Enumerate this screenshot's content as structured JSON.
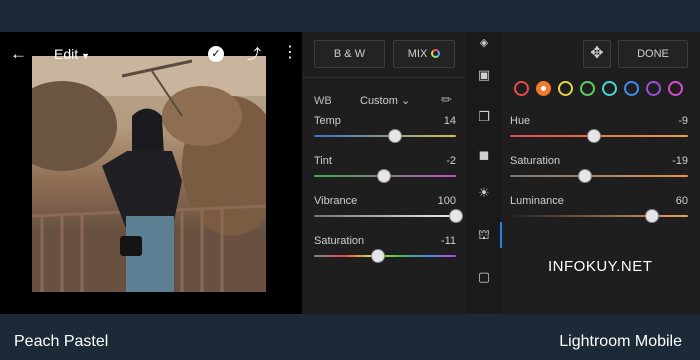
{
  "caption": {
    "left": "Peach Pastel",
    "right": "Lightroom Mobile"
  },
  "photo_panel": {
    "back_icon": "arrow-left-icon",
    "title": "Edit",
    "confirm_icon": "checkmark-circle-icon",
    "share_icon": "share-icon",
    "more_icon": "more-vertical-icon"
  },
  "color_panel": {
    "bw_label": "B & W",
    "mix_label": "MIX",
    "wb_label": "WB",
    "wb_value": "Custom",
    "sliders": [
      {
        "label": "Temp",
        "value": "14",
        "fraction": 0.57
      },
      {
        "label": "Tint",
        "value": "-2",
        "fraction": 0.49
      },
      {
        "label": "Vibrance",
        "value": "100",
        "fraction": 1.0
      },
      {
        "label": "Saturation",
        "value": "-11",
        "fraction": 0.45
      }
    ]
  },
  "tools": [
    "auto-icon",
    "crop-icon",
    "presets-icon",
    "light-icon",
    "detail-icon",
    "color-icon",
    "vignette-icon"
  ],
  "mix_panel": {
    "done_label": "DONE",
    "swatch_colors": [
      "#e84b4b",
      "#f07a2e",
      "#e8d24a",
      "#5ccf5c",
      "#4ad6d6",
      "#3d8ff0",
      "#a04ed8",
      "#d94ad9"
    ],
    "selected_swatch": 1,
    "sliders": [
      {
        "label": "Hue",
        "value": "-9",
        "fraction": 0.47
      },
      {
        "label": "Saturation",
        "value": "-19",
        "fraction": 0.42
      },
      {
        "label": "Luminance",
        "value": "60",
        "fraction": 0.8
      }
    ],
    "watermark": "INFOKUY.NET"
  }
}
